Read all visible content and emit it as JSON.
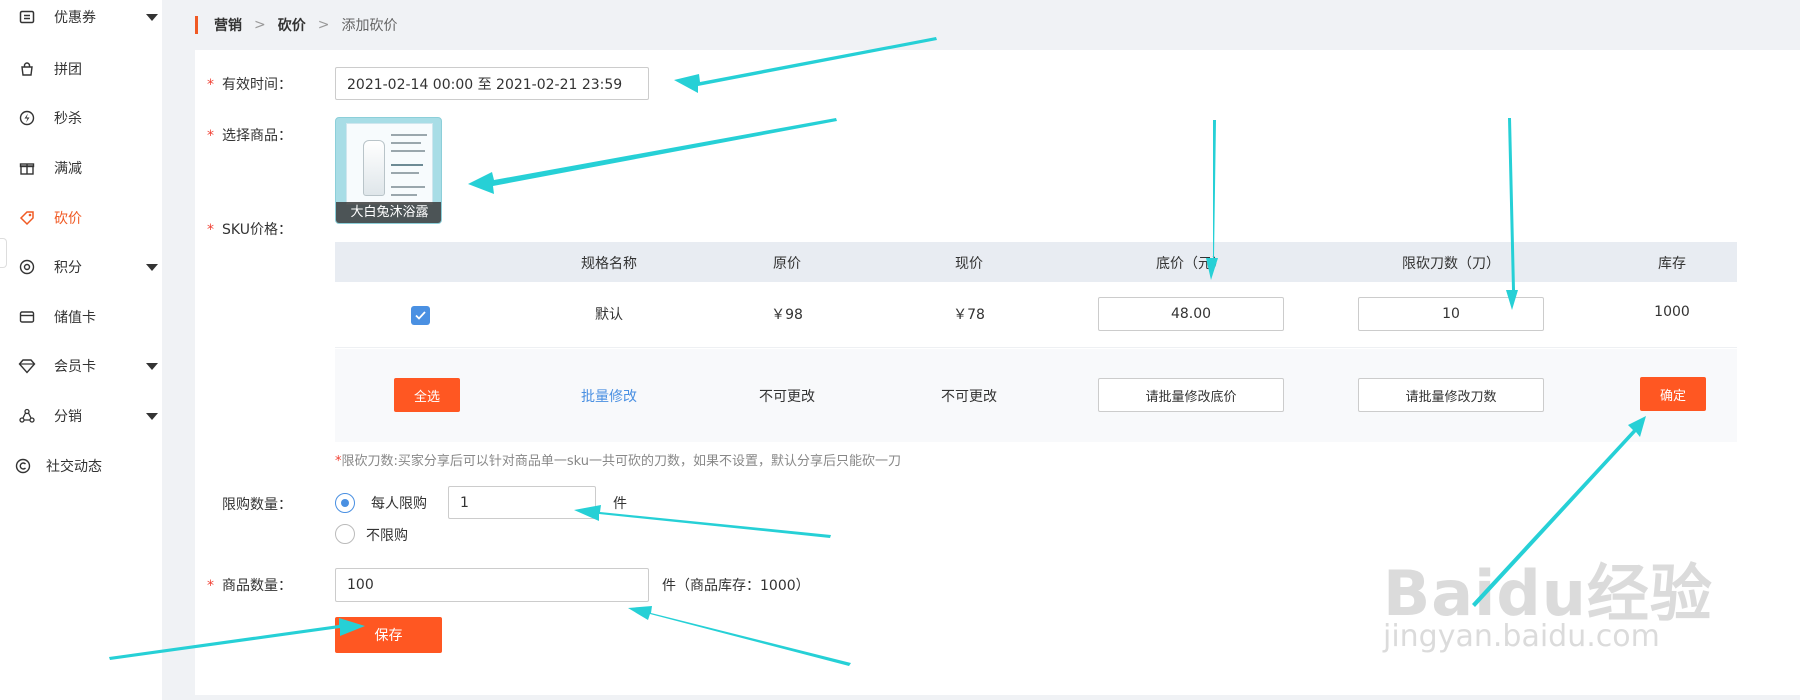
{
  "sidebar": {
    "items": [
      {
        "label": "优惠券",
        "icon": "coupon-icon",
        "caret": true,
        "active": false
      },
      {
        "label": "拼团",
        "icon": "group-buy-icon",
        "caret": false,
        "active": false
      },
      {
        "label": "秒杀",
        "icon": "flash-sale-icon",
        "caret": false,
        "active": false
      },
      {
        "label": "满减",
        "icon": "gift-icon",
        "caret": false,
        "active": false
      },
      {
        "label": "砍价",
        "icon": "bargain-icon",
        "caret": false,
        "active": true
      },
      {
        "label": "积分",
        "icon": "points-icon",
        "caret": true,
        "active": false
      },
      {
        "label": "储值卡",
        "icon": "card-icon",
        "caret": false,
        "active": false
      },
      {
        "label": "会员卡",
        "icon": "diamond-icon",
        "caret": true,
        "active": false
      },
      {
        "label": "分销",
        "icon": "distribution-icon",
        "caret": true,
        "active": false
      },
      {
        "label": "社交动态",
        "icon": "social-icon",
        "caret": false,
        "active": false
      }
    ]
  },
  "breadcrumb": {
    "items": [
      "营销",
      "砍价",
      "添加砍价"
    ],
    "separator": ">"
  },
  "form": {
    "valid_time": {
      "label": "有效时间：",
      "value": "2021-02-14 00:00 至 2021-02-21 23:59"
    },
    "product": {
      "label": "选择商品：",
      "name": "大白兔沐浴露"
    },
    "sku": {
      "label": "SKU价格：",
      "headers": [
        "规格名称",
        "原价",
        "现价",
        "底价（元）",
        "限砍刀数（刀）",
        "库存"
      ],
      "row": {
        "checked": true,
        "name": "默认",
        "original_price": "￥98",
        "current_price": "￥78",
        "floor_price": "48.00",
        "cut_count": "10",
        "stock": "1000"
      },
      "batch": {
        "select_all": "全选",
        "batch_edit": "批量修改",
        "original_locked": "不可更改",
        "current_locked": "不可更改",
        "floor_placeholder": "请批量修改底价",
        "cut_placeholder": "请批量修改刀数",
        "confirm": "确定"
      },
      "hint": "限砍刀数:买家分享后可以针对商品单一sku一共可砍的刀数，如果不设置，默认分享后只能砍一刀"
    },
    "limit": {
      "label": "限购数量：",
      "option_per_user": "每人限购",
      "value": "1",
      "unit": "件",
      "option_unlimited": "不限购",
      "selected": "per_user"
    },
    "quantity": {
      "label": "商品数量：",
      "value": "100",
      "suffix": "件（商品库存：1000）"
    },
    "save": "保存"
  },
  "watermark": {
    "brand": "Baidu经验",
    "url": "jingyan.baidu.com"
  },
  "colors": {
    "accent": "#ff5722",
    "link": "#4a90e2",
    "arrow": "#26d0d6",
    "required": "#f04134"
  }
}
